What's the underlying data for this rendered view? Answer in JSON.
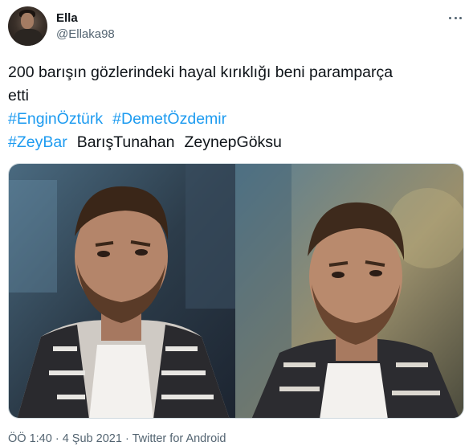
{
  "author": {
    "name": "Ella",
    "handle": "@Ellaka98",
    "avatar_icon": "profile-photo"
  },
  "more_icon": "more-options-icon",
  "tweet": {
    "line1": "200 barışın gözlerindeki hayal kırıklığı beni paramparça",
    "line2": "etti",
    "hashtags_row1": [
      "#EnginÖztürk",
      "#DemetÖzdemir"
    ],
    "hashtag_row2": "#ZeyBar",
    "plain_words_row2": [
      "BarışTunahan",
      "ZeynepGöksu"
    ]
  },
  "media": {
    "photo_count": 2,
    "photos": [
      "photo-left",
      "photo-right"
    ]
  },
  "meta": {
    "time": "ÖÖ 1:40",
    "separator": "·",
    "date": "4 Şub 2021",
    "source": "Twitter for Android"
  },
  "colors": {
    "link": "#1d9bf0",
    "secondary": "#536471",
    "text": "#0f1419"
  }
}
